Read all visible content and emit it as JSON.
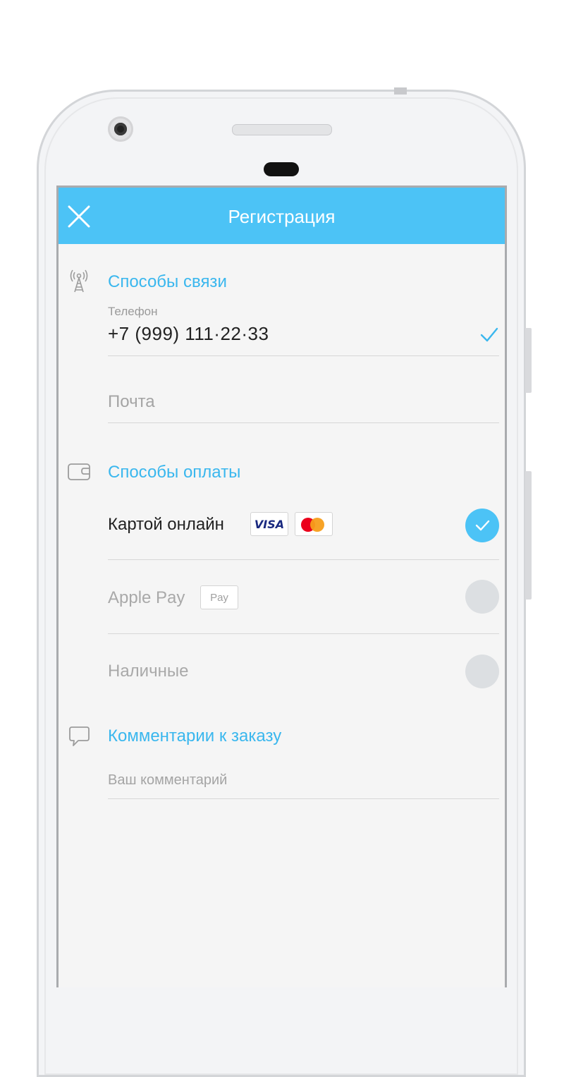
{
  "app": {
    "title": "Регистрация"
  },
  "contact": {
    "section_title": "Способы связи",
    "phone_label": "Телефон",
    "phone_value": "+7 (999) 111·22·33",
    "email_placeholder": "Почта"
  },
  "payment": {
    "section_title": "Способы оплаты",
    "options": [
      {
        "label": "Картой онлайн",
        "selected": true,
        "badges": [
          "VISA",
          "mastercard"
        ]
      },
      {
        "label": "Apple Pay",
        "selected": false,
        "badges": [
          "Pay"
        ]
      },
      {
        "label": "Наличные",
        "selected": false,
        "badges": []
      }
    ],
    "visa_text": "VISA",
    "applepay_badge": " Pay"
  },
  "comment": {
    "section_title": "Комментарии к заказу",
    "placeholder": "Ваш комментарий"
  },
  "colors": {
    "accent": "#4cc3f6",
    "section_title": "#3ab7ee",
    "inactive_radio": "#dcdfe2"
  },
  "icons": {
    "close": "close-icon",
    "contact": "antenna-icon",
    "payment": "wallet-icon",
    "comment": "speech-bubble-icon",
    "check": "check-icon"
  }
}
